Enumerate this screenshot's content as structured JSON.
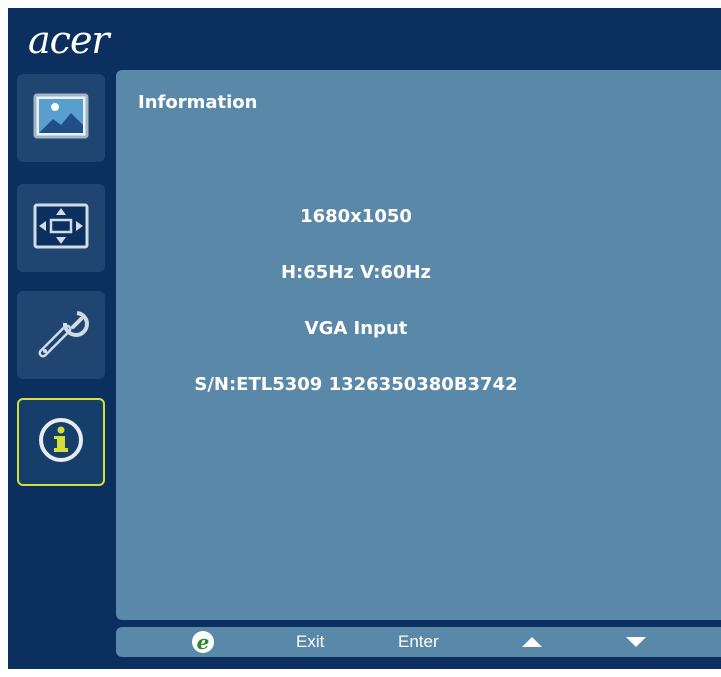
{
  "brand": {
    "logo_text": "acer"
  },
  "sidebar": {
    "items": [
      {
        "name": "picture",
        "icon": "picture-icon",
        "selected": false
      },
      {
        "name": "osd",
        "icon": "osd-position-icon",
        "selected": false
      },
      {
        "name": "setting",
        "icon": "wrench-icon",
        "selected": false
      },
      {
        "name": "information",
        "icon": "info-icon",
        "selected": true
      }
    ],
    "selected_color": "#d4de3a"
  },
  "panel": {
    "title": "Information",
    "resolution": "1680x1050",
    "frequency": "H:65Hz  V:60Hz",
    "input": "VGA Input",
    "serial": "S/N:ETL5309 1326350380B3742"
  },
  "footer": {
    "empowering_icon": "empowering-e-icon",
    "exit_label": "Exit",
    "enter_label": "Enter",
    "up_icon": "up-arrow-icon",
    "down_icon": "down-arrow-icon"
  },
  "colors": {
    "background": "#0b2f5f",
    "panel": "#5a88a8",
    "button": "#1f4570",
    "text": "#ffffff",
    "accent_green": "#2a8a2a"
  }
}
